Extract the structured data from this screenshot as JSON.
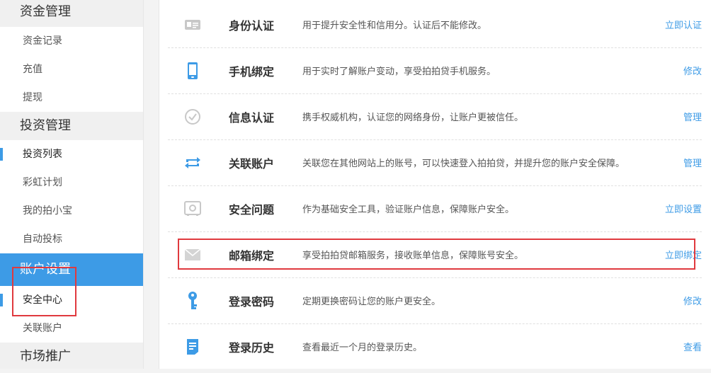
{
  "sidebar": {
    "sections": [
      {
        "title": "资金管理",
        "items": [
          "资金记录",
          "充值",
          "提现"
        ]
      },
      {
        "title": "投资管理",
        "items": [
          "投资列表",
          "彩虹计划",
          "我的拍小宝",
          "自动投标"
        ]
      },
      {
        "title": "账户设置",
        "items": [
          "安全中心",
          "关联账户"
        ]
      },
      {
        "title": "市场推广",
        "items": []
      }
    ]
  },
  "security": {
    "rows": [
      {
        "icon": "id-card-icon",
        "title": "身份认证",
        "desc": "用于提升安全性和信用分。认证后不能修改。",
        "action": "立即认证"
      },
      {
        "icon": "mobile-phone-icon",
        "title": "手机绑定",
        "desc": "用于实时了解账户变动，享受拍拍贷手机服务。",
        "action": "修改"
      },
      {
        "icon": "check-circle-icon",
        "title": "信息认证",
        "desc": "携手权威机构，认证您的网络身份，让账户更被信任。",
        "action": "管理"
      },
      {
        "icon": "link-arrows-icon",
        "title": "关联账户",
        "desc": "关联您在其他网站上的账号，可以快速登入拍拍贷，并提升您的账户安全保障。",
        "action": "管理"
      },
      {
        "icon": "safe-box-icon",
        "title": "安全问题",
        "desc": "作为基础安全工具，验证账户信息，保障账户安全。",
        "action": "立即设置"
      },
      {
        "icon": "envelope-icon",
        "title": "邮箱绑定",
        "desc": "享受拍拍贷邮箱服务，接收账单信息，保障账号安全。",
        "action": "立即绑定"
      },
      {
        "icon": "key-icon",
        "title": "登录密码",
        "desc": "定期更换密码让您的账户更安全。",
        "action": "修改"
      },
      {
        "icon": "document-icon",
        "title": "登录历史",
        "desc": "查看最近一个月的登录历史。",
        "action": "查看"
      }
    ]
  },
  "colors": {
    "accent": "#3d9be6",
    "highlight": "#e0393e",
    "icon_gray": "#cccccc"
  }
}
